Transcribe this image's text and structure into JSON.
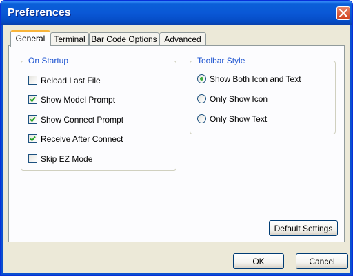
{
  "window": {
    "title": "Preferences"
  },
  "tabs": [
    {
      "label": "General",
      "active": true
    },
    {
      "label": "Terminal",
      "active": false
    },
    {
      "label": "Bar Code Options",
      "active": false
    },
    {
      "label": "Advanced",
      "active": false
    }
  ],
  "on_startup": {
    "legend": "On Startup",
    "options": [
      {
        "label": "Reload Last File",
        "checked": false
      },
      {
        "label": "Show Model Prompt",
        "checked": true
      },
      {
        "label": "Show Connect Prompt",
        "checked": true
      },
      {
        "label": "Receive After Connect",
        "checked": true
      },
      {
        "label": "Skip EZ Mode",
        "checked": false
      }
    ]
  },
  "toolbar_style": {
    "legend": "Toolbar Style",
    "options": [
      {
        "label": "Show Both Icon and Text",
        "selected": true
      },
      {
        "label": "Only Show Icon",
        "selected": false
      },
      {
        "label": "Only Show Text",
        "selected": false
      }
    ]
  },
  "buttons": {
    "default_settings": "Default Settings",
    "ok": "OK",
    "cancel": "Cancel"
  },
  "colors": {
    "title_bar": "#0a58d6",
    "group_legend": "#1c53d0",
    "check_mark": "#21a121",
    "radio_dot": "#3dab3d",
    "tab_highlight": "#f8b43a"
  }
}
